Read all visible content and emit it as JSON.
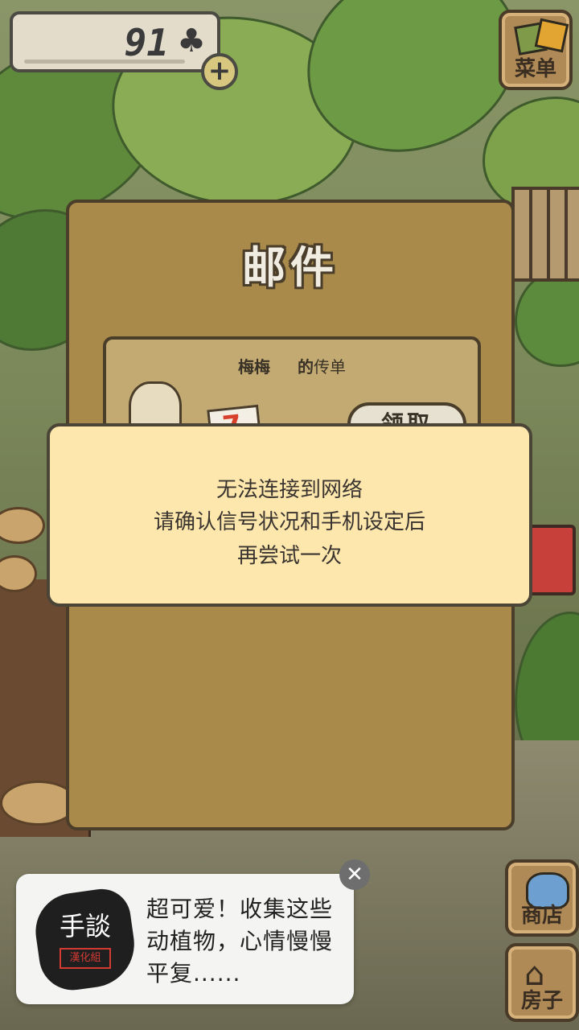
{
  "top_bar": {
    "clover_count": "91",
    "clover_icon": "♣",
    "add_icon": "+"
  },
  "side_menu": {
    "menu_label": "菜单",
    "shop_label": "商店",
    "house_label": "房子"
  },
  "mail_panel": {
    "title": "邮件",
    "item": {
      "sender": "梅梅",
      "suffix_bold": "的",
      "suffix": "传单",
      "claim_label": "领取"
    }
  },
  "error_dialog": {
    "line1": "无法连接到网络",
    "line2": "请确认信号状况和手机设定后",
    "line3": "再尝试一次"
  },
  "ad_banner": {
    "logo_title": "手談",
    "logo_sub": "漢化組",
    "text": "超可爱！收集这些动植物，心情慢慢平复......",
    "close_icon": "✕"
  }
}
